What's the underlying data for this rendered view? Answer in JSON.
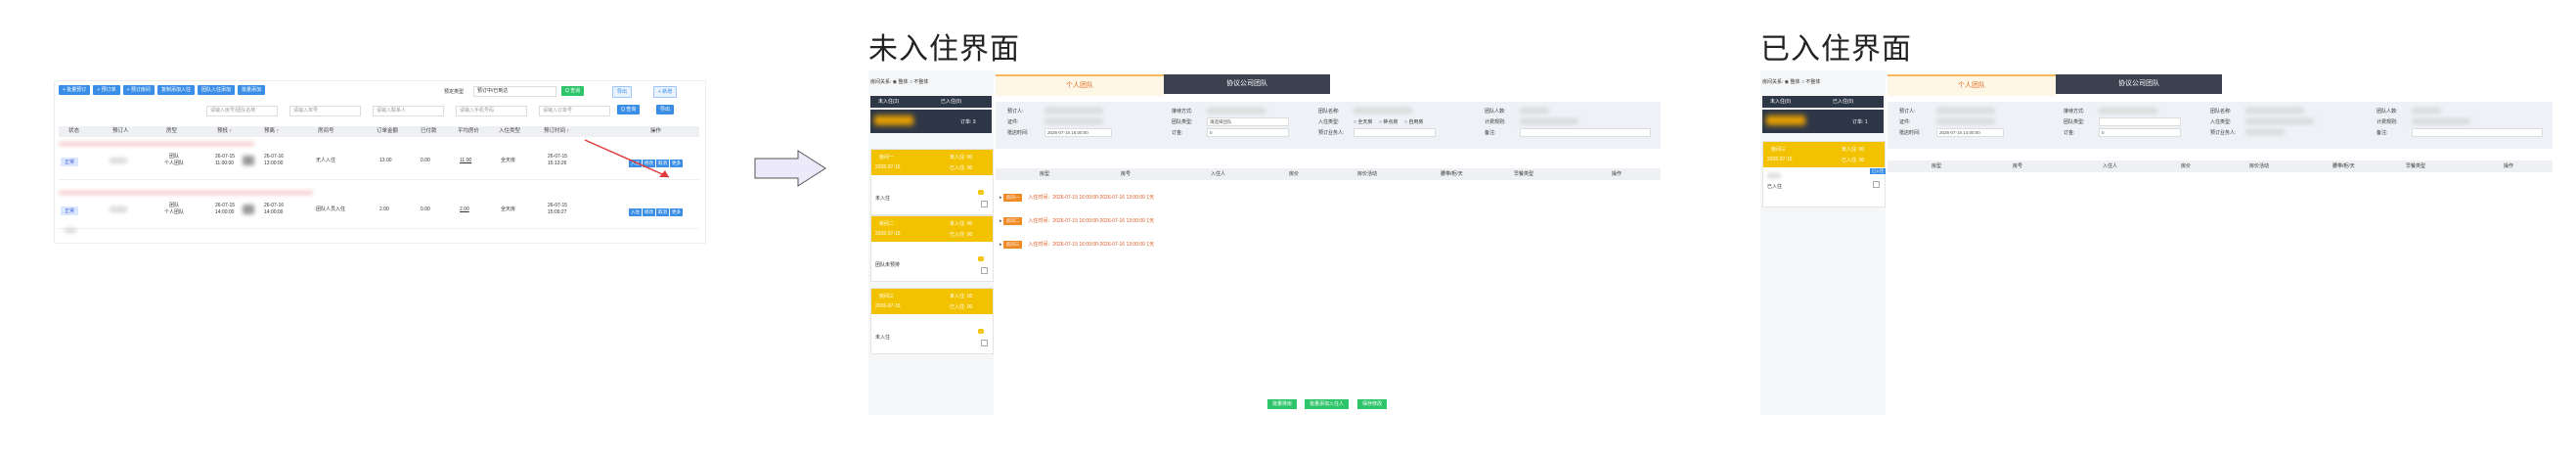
{
  "titles": {
    "not_checked_in": "未入住界面",
    "checked_in": "已入住界面"
  },
  "left": {
    "toolbar": [
      "+ 批量预订",
      "+ 预订单",
      "+ 预订房间",
      "复制添加入住",
      "团队入住添加",
      "批量添加"
    ],
    "order_label": "预定类型",
    "order_select": "预订中/已到达",
    "search_btn": "Q 查询",
    "export_btn": "导出",
    "add_btn": "+ 新增",
    "filters": [
      "请输入房号/团队名称",
      "请输入单号",
      "请输入联系人",
      "请输入手机号码",
      "请输入订单号"
    ],
    "headers": [
      "状态",
      "预订人",
      "房型",
      "预抵 ↑",
      "预离 ↑",
      "房间号",
      "订单金额",
      "已付款",
      "平均房价",
      "入住类型",
      "预订时间 ↑",
      "操作"
    ],
    "rows": [
      {
        "status": "正常",
        "room_type": "团队\n个人团队",
        "arrive": "26-07-15\n11:00:00",
        "leave": "26-07-16\n13:00:00",
        "room": "无人入住",
        "amount": "13.00",
        "paid": "0.00",
        "avg": "11.00",
        "type": "全天房",
        "time": "26-07-15\n15:13:26",
        "ops": [
          "入住",
          "修改",
          "取消",
          "更多"
        ]
      },
      {
        "status": "正常",
        "room_type": "团队\n个人团队",
        "arrive": "26-07-15\n14:00:00",
        "leave": "26-07-16\n14:00:00",
        "room": "团队人员入住",
        "amount": "2.00",
        "paid": "0.00",
        "avg": "2.00",
        "type": "全天房",
        "time": "26-07-15\n15:09:27",
        "ops": [
          "入住",
          "修改",
          "取消",
          "更多"
        ]
      }
    ]
  },
  "mid": {
    "top_label": "房间关系:",
    "top_opts": [
      "整体",
      "不整体"
    ],
    "sb_not_in": "未入住(3)",
    "sb_in": "已入住(0)",
    "sb_count": "订单: 3",
    "rooms": [
      {
        "name": "房间一",
        "date": "2026-07-15",
        "state": "未入住: 00",
        "state2": "已入住: 00",
        "person": "未入住"
      },
      {
        "name": "房间二",
        "date": "2026-07-15",
        "state": "未入住: 00",
        "state2": "已入住: 00",
        "person": "团队未预排"
      },
      {
        "name": "房间三",
        "date": "2026-07-15",
        "state": "未入住: 00",
        "state2": "已入住: 00",
        "person": "未入住"
      }
    ],
    "tabs": [
      "个人团队",
      "协议公司团队"
    ],
    "form": {
      "labels_col1": [
        "预订人:",
        "证件:",
        "抵店时间:"
      ],
      "labels_col2": [
        "接待方式:",
        "团队类型:",
        "订金:"
      ],
      "labels_col3": [
        "团队名称:",
        "入住类型:",
        "预订业务人:"
      ],
      "labels_col4": [
        "团队人数:",
        "计费规则:",
        "备注:"
      ],
      "arrive_value": "2026-07-15 16:00:00",
      "deposit_value": "0",
      "type_options": [
        "全天房",
        "钟点房",
        "自用房"
      ],
      "team_type_value": "请选择团队"
    },
    "table_headers": [
      "房型",
      "房号",
      "入住人",
      "房价",
      "房价活动",
      "腰带/柜/天",
      "早餐类型",
      "操作"
    ],
    "entries": [
      {
        "badge": "房间一",
        "text": "入住时间：2026-07-15 16:00:00-2026-07-16 13:00:00   1天"
      },
      {
        "badge": "房间二",
        "text": "入住时间：2026-07-15 16:00:00-2026-07-16 13:00:00   1天"
      },
      {
        "badge": "房间三",
        "text": "入住时间：2026-07-15 16:00:00-2026-07-16 13:00:00   1天"
      }
    ],
    "bottom_buttons": [
      "批量排房",
      "批量添加入住人",
      "保存修改"
    ]
  },
  "right": {
    "sb_not_in": "未入住(0)",
    "sb_in": "已入住(0)",
    "sb_count": "订单: 1",
    "room": {
      "name": "房间三",
      "date": "2026-07-15",
      "state": "未入住: 00",
      "state2": "已入住: 00",
      "tag": "已入住",
      "person": "已入住"
    },
    "arrive_value": "2026-07-15 14:00:00",
    "deposit_value": "0",
    "table_headers": [
      "房型",
      "房号",
      "入住人",
      "房价",
      "房价活动",
      "腰带/柜/天",
      "早餐类型",
      "操作"
    ]
  },
  "colors": {
    "blue": "#3a8ee6",
    "yellow": "#f2c200",
    "dark": "#2d3748",
    "orange": "#f08a24",
    "green": "#2ec46a"
  }
}
